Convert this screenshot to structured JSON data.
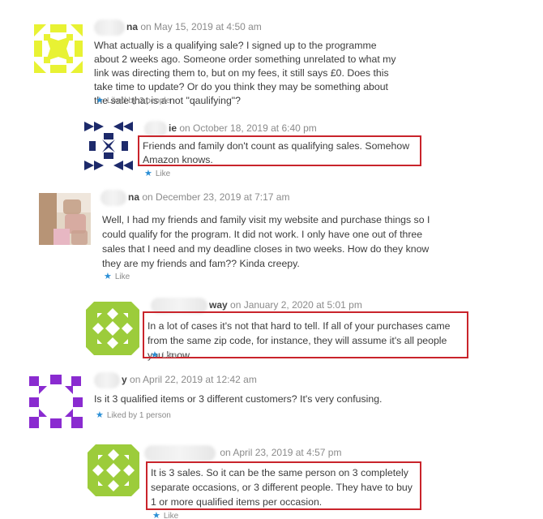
{
  "comments": [
    {
      "name_visible": "na",
      "date": "on May 15, 2019 at 4:50 am",
      "text": "What actually is a qualifying sale? I signed up to the programme about 2 weeks ago. Someone order something unrelated to what my link was directing them to, but on my fees, it still says £0. Does this take time to update? Or do you think they may be something about the sale that is a not \"qaulifying\"?",
      "like": "Liked by 2 people",
      "avatar_color": "#e8f233"
    },
    {
      "name_visible": "ie",
      "date": "on October 18, 2019 at 6:40 pm",
      "text": "Friends and family don't count as qualifying sales. Somehow Amazon knows.",
      "like": "Like",
      "avatar_color": "#1d2a6b"
    },
    {
      "name_visible": "na",
      "date": "on December 23, 2019 at 7:17 am",
      "text": "Well, I had my friends and family visit my website and purchase things so I could qualify for the program. It did not work. I only have one out of three sales that I need and my deadline closes in two weeks. How do they know they are my friends and fam?? Kinda creepy.",
      "like": "Like",
      "avatar_color": "#c9a58a"
    },
    {
      "name_visible": "way",
      "date": "on January 2, 2020 at 5:01 pm",
      "text": "In a lot of cases it's not that hard to tell. If all of your purchases came from the same zip code, for instance, they will assume it's all people you know.",
      "like": "Like",
      "avatar_color": "#9ccc3b"
    },
    {
      "name_visible": "y",
      "date": "on April 22, 2019 at 12:42 am",
      "text": "Is it 3 qualified items or 3 different customers? It's very confusing.",
      "like": "Liked by 1 person",
      "avatar_color": "#8a2bd0"
    },
    {
      "name_visible": "",
      "date": "on April 23, 2019 at 4:57 pm",
      "text": "It is 3 sales. So it can be the same person on 3 completely separate occasions, or 3 different people. They have to buy 1 or more qualified items per occasion.",
      "like": "Like",
      "avatar_color": "#9ccc3b"
    }
  ],
  "highlight_color": "#c9242b",
  "like_icon": "star-icon"
}
